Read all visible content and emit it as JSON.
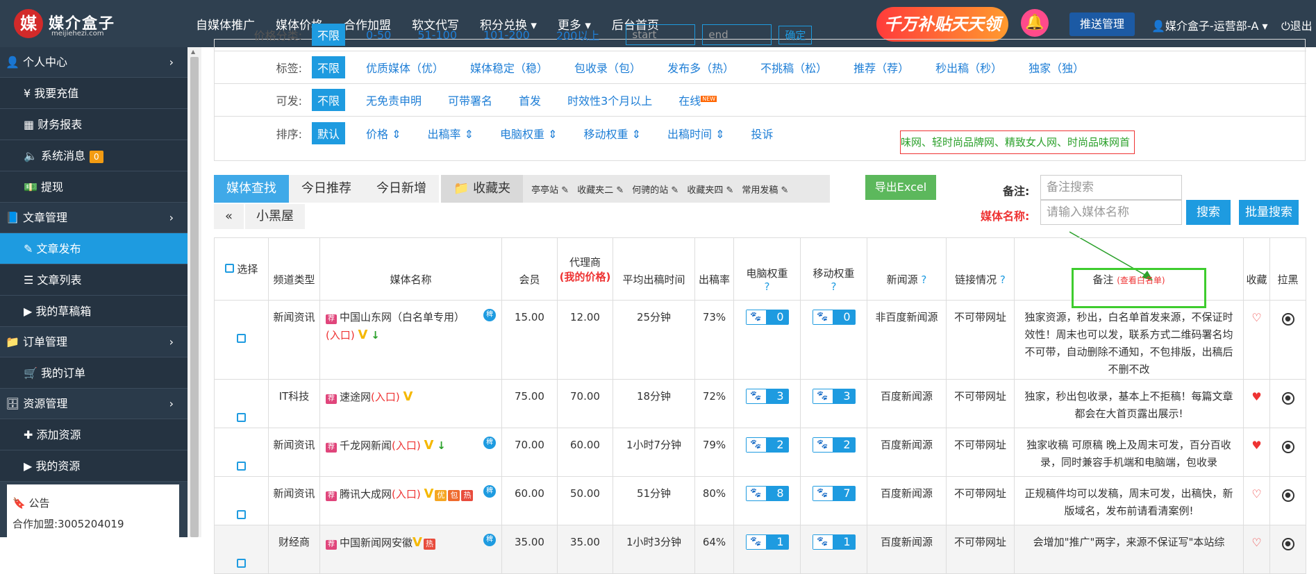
{
  "header": {
    "logo_char": "媒",
    "logo_title": "媒介盒子",
    "logo_sub": "meijiehezi.com",
    "nav": [
      "自媒体推广",
      "媒体价格",
      "合作加盟",
      "软文代写",
      "积分兑换 ▾",
      "更多 ▾",
      "后台首页"
    ],
    "promo": "千万补贴天天领",
    "push_btn": "推送管理",
    "user": "媒介盒子-运营部-A ▾",
    "logout": "退出"
  },
  "sidebar": {
    "personal": "个人中心",
    "items1": [
      "¥ 我要充值",
      "财务报表",
      "系统消息",
      "提现"
    ],
    "msg_count": "0",
    "article": "文章管理",
    "items2": [
      "文章发布",
      "文章列表",
      "我的草稿箱"
    ],
    "order": "订单管理",
    "items3": [
      "我的订单"
    ],
    "resource": "资源管理",
    "items4": [
      "添加资源",
      "我的资源"
    ],
    "notice_title": "公告",
    "notice_line": "合作加盟:3005204019"
  },
  "filters": {
    "price_label": "价格分类:",
    "price_opts": [
      "不限",
      "0-50",
      "51-100",
      "101-200",
      "200以上"
    ],
    "price_start": "start",
    "price_end": "end",
    "price_ok": "确定",
    "tag_label": "标签:",
    "tag_opts": [
      "不限",
      "优质媒体（优）",
      "媒体稳定（稳）",
      "包收录（包）",
      "发布多（热）",
      "不挑稿（松）",
      "推荐（荐）",
      "秒出稿（秒）",
      "独家（独）"
    ],
    "can_label": "可发:",
    "can_opts": [
      "不限",
      "无免责申明",
      "可带署名",
      "首发",
      "时效性3个月以上",
      "在线"
    ],
    "new_badge": "NEW",
    "sort_label": "排序:",
    "sort_opts": [
      "默认",
      "价格 ⇕",
      "出稿率 ⇕",
      "电脑权重 ⇕",
      "移动权重 ⇕",
      "出稿时间 ⇕",
      "投诉"
    ],
    "ticker": "味网、轻时尚品牌网、精致女人网、时尚品味网首"
  },
  "tabs": [
    "媒体查找",
    "今日推荐",
    "今日新增"
  ],
  "favorites": {
    "title": "收藏夹",
    "items": [
      "亭亭站",
      "收藏夹二",
      "何骋的站",
      "收藏夹四",
      "常用发稿"
    ]
  },
  "tabs2": [
    "«",
    "小黑屋"
  ],
  "export_label": "导出Excel",
  "remark_label": "备注:",
  "media_name_label": "媒体名称:",
  "remark_placeholder": "备注搜索",
  "media_placeholder": "请输入媒体名称",
  "search_btn": "搜索",
  "batch_btn": "批量搜索",
  "table": {
    "headers": [
      "选择",
      "频道类型",
      "媒体名称",
      "会员",
      "代理商",
      "(我的价格)",
      "平均出稿时间",
      "出稿率",
      "电脑权重",
      "移动权重",
      "新闻源",
      "链接情况",
      "备注",
      "(查看白名单)",
      "收藏",
      "拉黑"
    ],
    "rows": [
      {
        "type": "新闻资讯",
        "name": "中国山东网（白名单专用）",
        "member": "15.00",
        "agent": "12.00",
        "time": "25分钟",
        "rate": "73%",
        "pc": "0",
        "mobile": "0",
        "news": "非百度新闻源",
        "link": "不可带网址",
        "remark": "独家资源，秒出，白名单首发来源，不保证时效性！周末也可以发，联系方式二维码署名均不可带，自动删除不通知，不包排版，出稿后不删不改",
        "fav": "♡"
      },
      {
        "type": "IT科技",
        "name": "速途网",
        "member": "75.00",
        "agent": "70.00",
        "time": "18分钟",
        "rate": "72%",
        "pc": "3",
        "mobile": "3",
        "news": "百度新闻源",
        "link": "不可带网址",
        "remark": "独家，秒出包收录，基本上不拒稿！每篇文章都会在大首页露出展示!",
        "fav": "♥"
      },
      {
        "type": "新闻资讯",
        "name": "千龙网新闻",
        "member": "70.00",
        "agent": "60.00",
        "time": "1小时7分钟",
        "rate": "79%",
        "pc": "2",
        "mobile": "2",
        "news": "百度新闻源",
        "link": "不可带网址",
        "remark": "独家收稿 可原稿 晚上及周末可发，百分百收录，同时兼容手机端和电脑端，包收录",
        "fav": "♥"
      },
      {
        "type": "新闻资讯",
        "name": "腾讯大成网",
        "member": "60.00",
        "agent": "50.00",
        "time": "51分钟",
        "rate": "80%",
        "pc": "8",
        "mobile": "7",
        "news": "百度新闻源",
        "link": "不可带网址",
        "remark": "正规稿件均可以发稿，周末可发，出稿快，新版域名，发布前请看清案例!",
        "fav": "♡"
      },
      {
        "type": "财经商",
        "name": "中国新闻网安徽",
        "member": "35.00",
        "agent": "35.00",
        "time": "1小时3分钟",
        "rate": "64%",
        "pc": "1",
        "mobile": "1",
        "news": "百度新闻源",
        "link": "不可带网址",
        "remark": "会增加\"推广\"两字，来源不保证写\"本站综",
        "fav": "♡"
      }
    ],
    "entry": "(入口)",
    "tag_tui": "荐",
    "v_mark": "V",
    "down_mark": "↓",
    "pei_mark": "稗",
    "tag_you": "优",
    "tag_bao": "包",
    "tag_re": "热",
    "paw": "🐾"
  }
}
